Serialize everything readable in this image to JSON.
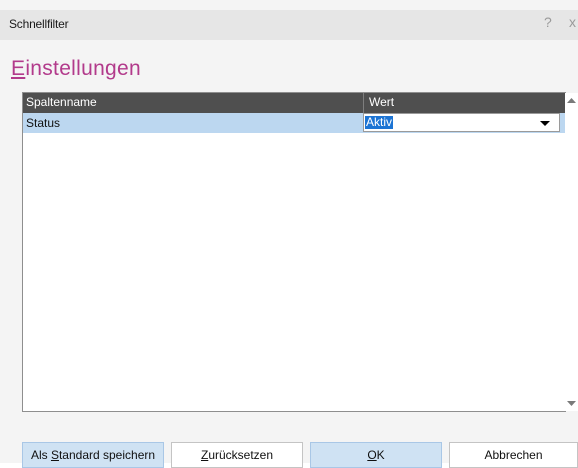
{
  "dialog": {
    "title": "Schnellfilter",
    "help_symbol": "?",
    "close_symbol": "x"
  },
  "heading": {
    "mnemonic": "E",
    "rest": "instellungen"
  },
  "grid": {
    "columns": [
      "Spaltenname",
      "Wert"
    ],
    "rows": [
      {
        "name": "Status",
        "value": "Aktiv"
      }
    ]
  },
  "buttons": {
    "save_default": {
      "pre": "Als ",
      "mnemonic": "S",
      "post": "tandard speichern"
    },
    "reset": {
      "pre": "",
      "mnemonic": "Z",
      "post": "urücksetzen"
    },
    "ok": {
      "pre": "",
      "mnemonic": "O",
      "post": "K"
    },
    "cancel": {
      "pre": "",
      "mnemonic": "",
      "post": "Abbrechen"
    }
  },
  "colors": {
    "accent": "#b23a8b",
    "header_bg": "#4f4f4f",
    "row_selected": "#bcd7f0",
    "text_selection": "#1c74d4"
  },
  "icons": {
    "help": "question-mark",
    "close": "close-x",
    "dropdown": "dropdown-arrow",
    "scroll_up": "scroll-up-arrow",
    "scroll_down": "scroll-down-arrow"
  }
}
